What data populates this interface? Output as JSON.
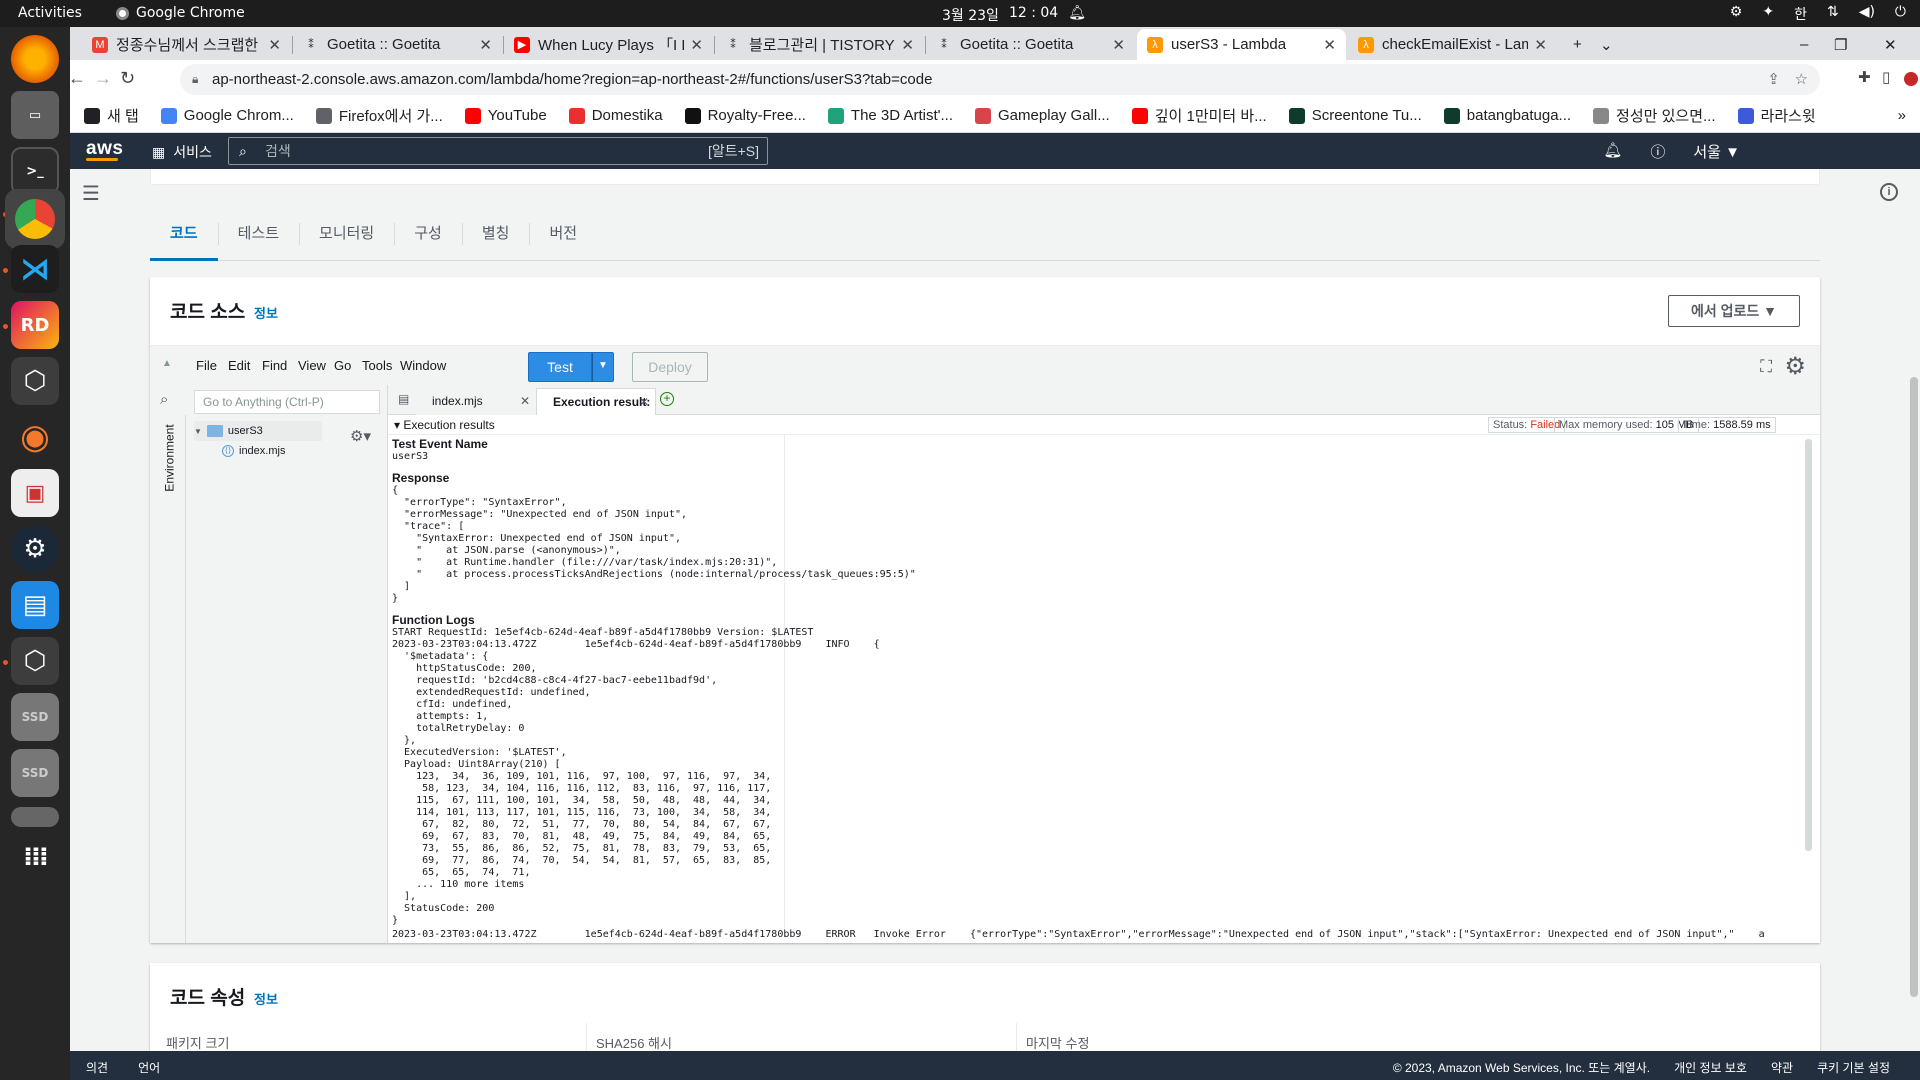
{
  "os": {
    "activities": "Activities",
    "app_name": "Google Chrome",
    "date": "3월 23일",
    "time": "12 : 04",
    "ime": "한"
  },
  "browser": {
    "tabs": [
      {
        "title": "정종수님께서 스크랩한 채",
        "fav": "M",
        "fav_color": "#ea4335"
      },
      {
        "title": "Goetita :: Goetita",
        "fav": "⁑",
        "fav_color": "#ffffff"
      },
      {
        "title": "When Lucy Plays 「I Reall",
        "fav": "▶",
        "fav_color": "#ff0000"
      },
      {
        "title": "블로그관리 | TISTORY",
        "fav": "⁑",
        "fav_color": "#ffffff"
      },
      {
        "title": "Goetita :: Goetita",
        "fav": "⁑",
        "fav_color": "#ffffff"
      },
      {
        "title": "userS3 - Lambda",
        "fav": "λ",
        "fav_color": "#ff9900"
      },
      {
        "title": "checkEmailExist - Lambd",
        "fav": "λ",
        "fav_color": "#ff9900"
      }
    ],
    "url": "ap-northeast-2.console.aws.amazon.com/lambda/home?region=ap-northeast-2#/functions/userS3?tab=code",
    "bookmarks": [
      {
        "label": "새 탭",
        "color": "#202124"
      },
      {
        "label": "Google Chrom...",
        "color": "#4285f4"
      },
      {
        "label": "Firefox에서 가...",
        "color": "#5f6368"
      },
      {
        "label": "YouTube",
        "color": "#ff0000"
      },
      {
        "label": "Domestika",
        "color": "#e8312f"
      },
      {
        "label": "Royalty-Free...",
        "color": "#111111"
      },
      {
        "label": "The 3D Artist'...",
        "color": "#1fa37a"
      },
      {
        "label": "Gameplay Gall...",
        "color": "#d9434b"
      },
      {
        "label": "깊이 1만미터 바...",
        "color": "#ff0000"
      },
      {
        "label": "Screentone Tu...",
        "color": "#0e3b2a"
      },
      {
        "label": "batangbatuga...",
        "color": "#0e3b2a"
      },
      {
        "label": "정성만 있으면...",
        "color": "#888888"
      },
      {
        "label": "라라스윗",
        "color": "#3b5bdb"
      }
    ]
  },
  "aws": {
    "services": "서비스",
    "search_placeholder": "검색",
    "search_shortcut": "[알트+S]",
    "region": "서울 ▼"
  },
  "function_tabs": [
    "코드",
    "테스트",
    "모니터링",
    "구성",
    "별칭",
    "버전"
  ],
  "code_source": {
    "title": "코드 소스",
    "info": "정보",
    "upload": "에서 업로드"
  },
  "ide": {
    "menu": [
      "File",
      "Edit",
      "Find",
      "View",
      "Go",
      "Tools",
      "Window"
    ],
    "test": "Test",
    "deploy": "Deploy",
    "goto_placeholder": "Go to Anything (Ctrl-P)",
    "env_label": "Environment",
    "tree_root": "userS3",
    "tree_file": "index.mjs",
    "tabs": [
      "index.mjs",
      "Execution result:"
    ],
    "results_title": "Execution results",
    "status_label": "Status:",
    "status_value": "Failed",
    "memory_label": "Max memory used:",
    "memory_value": "105 MB",
    "time_label": "Time:",
    "time_value": "1588.59 ms",
    "test_event_name_h": "Test Event Name",
    "test_event_name": "userS3",
    "response_h": "Response",
    "response": "{\n  \"errorType\": \"SyntaxError\",\n  \"errorMessage\": \"Unexpected end of JSON input\",\n  \"trace\": [\n    \"SyntaxError: Unexpected end of JSON input\",\n    \"    at JSON.parse (<anonymous>)\",\n    \"    at Runtime.handler (file:///var/task/index.mjs:20:31)\",\n    \"    at process.processTicksAndRejections (node:internal/process/task_queues:95:5)\"\n  ]\n}",
    "logs_h": "Function Logs",
    "logs": "START RequestId: 1e5ef4cb-624d-4eaf-b89f-a5d4f1780bb9 Version: $LATEST\n2023-03-23T03:04:13.472Z\t1e5ef4cb-624d-4eaf-b89f-a5d4f1780bb9\tINFO\t{\n  '$metadata': {\n    httpStatusCode: 200,\n    requestId: 'b2cd4c88-c8c4-4f27-bac7-eebe11badf9d',\n    extendedRequestId: undefined,\n    cfId: undefined,\n    attempts: 1,\n    totalRetryDelay: 0\n  },\n  ExecutedVersion: '$LATEST',\n  Payload: Uint8Array(210) [\n    123,  34,  36, 109, 101, 116,  97, 100,  97, 116,  97,  34,\n     58, 123,  34, 104, 116, 116, 112,  83, 116,  97, 116, 117,\n    115,  67, 111, 100, 101,  34,  58,  50,  48,  48,  44,  34,\n    114, 101, 113, 117, 101, 115, 116,  73, 100,  34,  58,  34,\n     67,  82,  80,  72,  51,  77,  70,  80,  54,  84,  67,  67,\n     69,  67,  83,  70,  81,  48,  49,  75,  84,  49,  84,  65,\n     73,  55,  86,  86,  52,  75,  81,  78,  83,  79,  53,  65,\n     69,  77,  86,  74,  70,  54,  54,  81,  57,  65,  83,  85,\n     65,  65,  74,  71,\n    ... 110 more items\n  ],\n  StatusCode: 200\n}",
    "last_log": "2023-03-23T03:04:13.472Z\t1e5ef4cb-624d-4eaf-b89f-a5d4f1780bb9\tERROR\tInvoke Error \t{\"errorType\":\"SyntaxError\",\"errorMessage\":\"Unexpected end of JSON input\",\"stack\":[\"SyntaxError: Unexpected end of JSON input\",\"    a"
  },
  "code_props": {
    "title": "코드 속성",
    "info": "정보",
    "cols": [
      "패키지 크기",
      "SHA256 해시",
      "마지막 수정"
    ]
  },
  "footer": {
    "feedback": "의견",
    "language": "언어",
    "copyright": "© 2023, Amazon Web Services, Inc. 또는 계열사.",
    "privacy": "개인 정보 보호",
    "terms": "약관",
    "cookie": "쿠키 기본 설정"
  }
}
